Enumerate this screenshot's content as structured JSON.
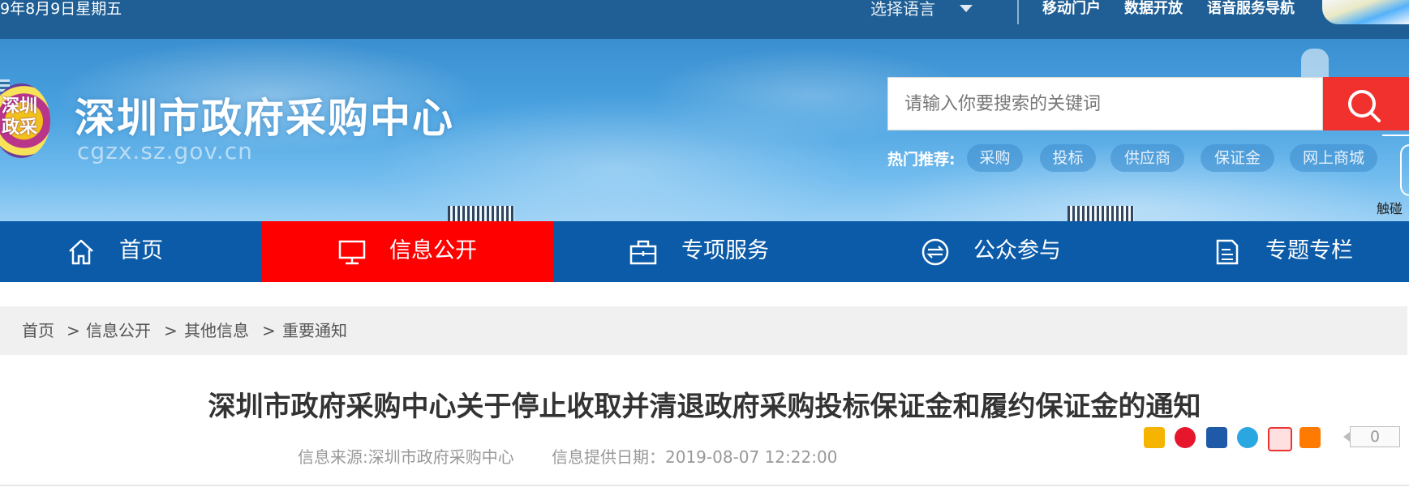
{
  "topbar": {
    "date": "9年8月9日星期五",
    "language_label": "选择语言",
    "links": [
      "移动门户",
      "数据开放",
      "语音服务导航"
    ]
  },
  "banner": {
    "logo_text": "深圳政采",
    "site_name": "深圳市政府采购中心",
    "site_domain": "cgzx.sz.gov.cn",
    "search": {
      "placeholder": "请输入你要搜索的关键词",
      "button_icon": "search-icon"
    },
    "hot_label": "热门推荐:",
    "hot_tags": [
      "采购",
      "投标",
      "供应商",
      "保证金",
      "网上商城"
    ],
    "side_text": "触碰"
  },
  "nav": {
    "items": [
      {
        "label": "首页",
        "icon": "home-icon"
      },
      {
        "label": "信息公开",
        "icon": "monitor-icon"
      },
      {
        "label": "专项服务",
        "icon": "briefcase-icon"
      },
      {
        "label": "公众参与",
        "icon": "exchange-icon"
      },
      {
        "label": "专题专栏",
        "icon": "document-icon"
      }
    ],
    "active_index": 1
  },
  "breadcrumb": {
    "items": [
      "首页",
      "信息公开",
      "其他信息",
      "重要通知"
    ],
    "separator": ">"
  },
  "article": {
    "title": "深圳市政府采购中心关于停止收取并清退政府采购投标保证金和履约保证金的通知",
    "source": "信息来源:深圳市政府采购中心",
    "date": "信息提供日期：2019-08-07 12:22:00",
    "share_count": "0"
  },
  "colors": {
    "topbar": "#1f5f95",
    "nav": "#0b5ba8",
    "nav_active": "#ff0000",
    "search_button": "#f1312e"
  }
}
